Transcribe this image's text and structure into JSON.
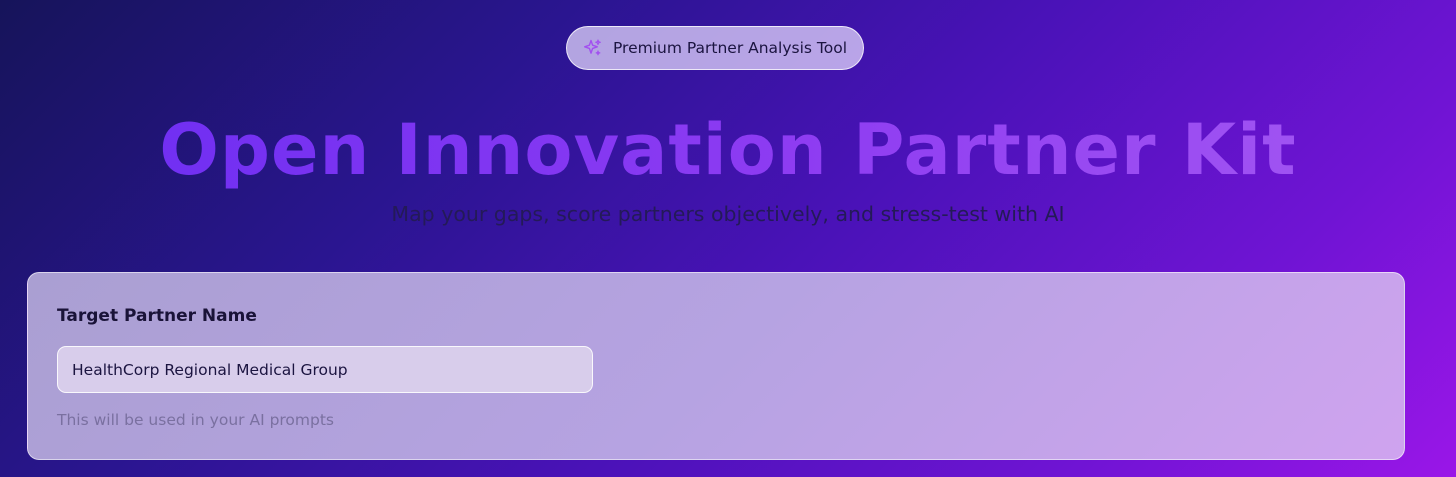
{
  "badge": {
    "icon": "sparkles-icon",
    "label": "Premium Partner Analysis Tool"
  },
  "hero": {
    "title": "Open Innovation Partner Kit",
    "subtitle": "Map your gaps, score partners objectively, and stress-test with AI"
  },
  "partner_form": {
    "label": "Target Partner Name",
    "value": "HealthCorp Regional Medical Group",
    "helper": "This will be used in your AI prompts"
  },
  "colors": {
    "background_start": "#16145a",
    "background_end": "#9a16e8",
    "title_accent": "#8e3cf2",
    "card_tint": "#b6a3e2"
  }
}
